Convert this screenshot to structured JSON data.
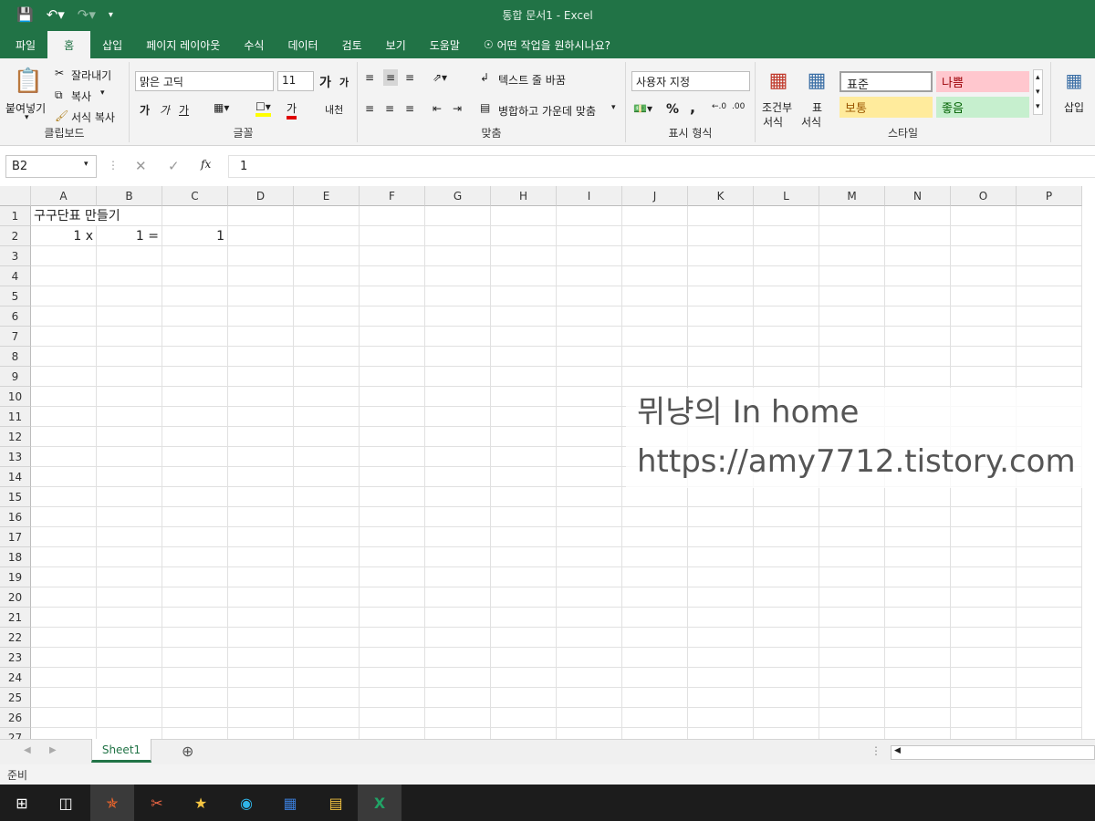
{
  "window": {
    "title": "통합 문서1  -  Excel"
  },
  "menu": [
    "파일",
    "홈",
    "삽입",
    "페이지 레이아웃",
    "수식",
    "데이터",
    "검토",
    "보기",
    "도움말"
  ],
  "tell_me": "어떤 작업을 원하시나요?",
  "ribbon": {
    "clipboard": {
      "paste": "붙여넣기",
      "cut": "잘라내기",
      "copy": "복사",
      "format_painter": "서식 복사",
      "label": "클립보드"
    },
    "font": {
      "name": "맑은 고딕",
      "size": "11",
      "bold": "가",
      "italic": "가",
      "underline": "가",
      "grow": "가",
      "shrink": "가",
      "font_color": "가",
      "phonetic": "내천",
      "label": "글꼴"
    },
    "align": {
      "wrap": "텍스트 줄 바꿈",
      "merge": "병합하고 가운데 맞춤",
      "label": "맞춤"
    },
    "number": {
      "format": "사용자 지정",
      "percent": "%",
      "comma": ",",
      "label": "표시 형식"
    },
    "styles": {
      "cond": [
        "조건부",
        "서식"
      ],
      "table": [
        "표",
        "서식"
      ],
      "normal": "표준",
      "bad": "나쁨",
      "neutral": "보통",
      "good": "좋음",
      "label": "스타일"
    },
    "insert": "삽입"
  },
  "formula": {
    "name_box": "B2",
    "fx": "fx",
    "value": "1"
  },
  "columns": [
    "A",
    "B",
    "C",
    "D",
    "E",
    "F",
    "G",
    "H",
    "I",
    "J",
    "K",
    "L",
    "M",
    "N",
    "O",
    "P"
  ],
  "rows": [
    "1",
    "2",
    "3",
    "4",
    "5",
    "6",
    "7",
    "8",
    "9",
    "10",
    "11",
    "12",
    "13",
    "14",
    "15",
    "16",
    "17",
    "18",
    "19",
    "20",
    "21",
    "22",
    "23",
    "24",
    "25",
    "26",
    "27"
  ],
  "cells": {
    "A1": "구구단표 만들기",
    "A2": "1 x",
    "B2": "1 =",
    "C2": "1"
  },
  "sheet_tab": "Sheet1",
  "status": "준비",
  "watermark": {
    "line1": "뮈냥의 In home",
    "line2": "https://amy7712.tistory.com"
  },
  "colors": {
    "accent": "#217346",
    "bad_bg": "#ffc7ce",
    "bad_fg": "#9c0006",
    "neutral_bg": "#ffeb9c",
    "neutral_fg": "#9c5700",
    "good_bg": "#c6efce",
    "good_fg": "#006100"
  }
}
